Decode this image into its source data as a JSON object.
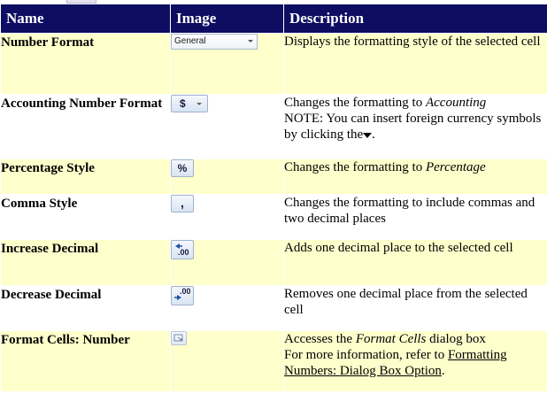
{
  "table": {
    "headers": {
      "name": "Name",
      "image": "Image",
      "description": "Description"
    },
    "rows": [
      {
        "name": "Number Format",
        "image_label": "General",
        "desc": "Displays the formatting style of the selected cell"
      },
      {
        "name": "Accounting Number Format",
        "image_label": "$",
        "desc_prefix": "Changes the formatting to ",
        "desc_italic": "Accounting",
        "note": "NOTE: You can insert foreign currency symbols by clicking the",
        "note_end": "."
      },
      {
        "name": "Percentage Style",
        "image_label": "%",
        "desc_prefix": "Changes the formatting to ",
        "desc_italic": "Percentage"
      },
      {
        "name": "Comma Style",
        "image_label": ",",
        "desc": "Changes the formatting to include commas and two decimal places"
      },
      {
        "name": "Increase Decimal",
        "image_label": ".00",
        "desc": "Adds one decimal place to the selected cell"
      },
      {
        "name": "Decrease Decimal",
        "image_label": ".00",
        "desc": "Removes one decimal place from the selected cell"
      },
      {
        "name": "Format Cells: Number",
        "desc_prefix": "Accesses the ",
        "desc_italic": "Format Cells",
        "desc_suffix": " dialog box",
        "more": "For more information, refer to ",
        "link": "Formatting Numbers: Dialog Box Option",
        "more_end": "."
      }
    ]
  },
  "icons": {
    "number_format": "dropdown-icon",
    "accounting": "dollar-sign-icon",
    "percent": "percent-icon",
    "comma": "comma-icon",
    "increase_decimal": "increase-decimal-icon",
    "decrease_decimal": "decrease-decimal-icon",
    "format_cells": "dialog-launcher-icon"
  },
  "colors": {
    "header_bg": "#0d0d62",
    "row_alt_bg": "#ffffcc"
  }
}
